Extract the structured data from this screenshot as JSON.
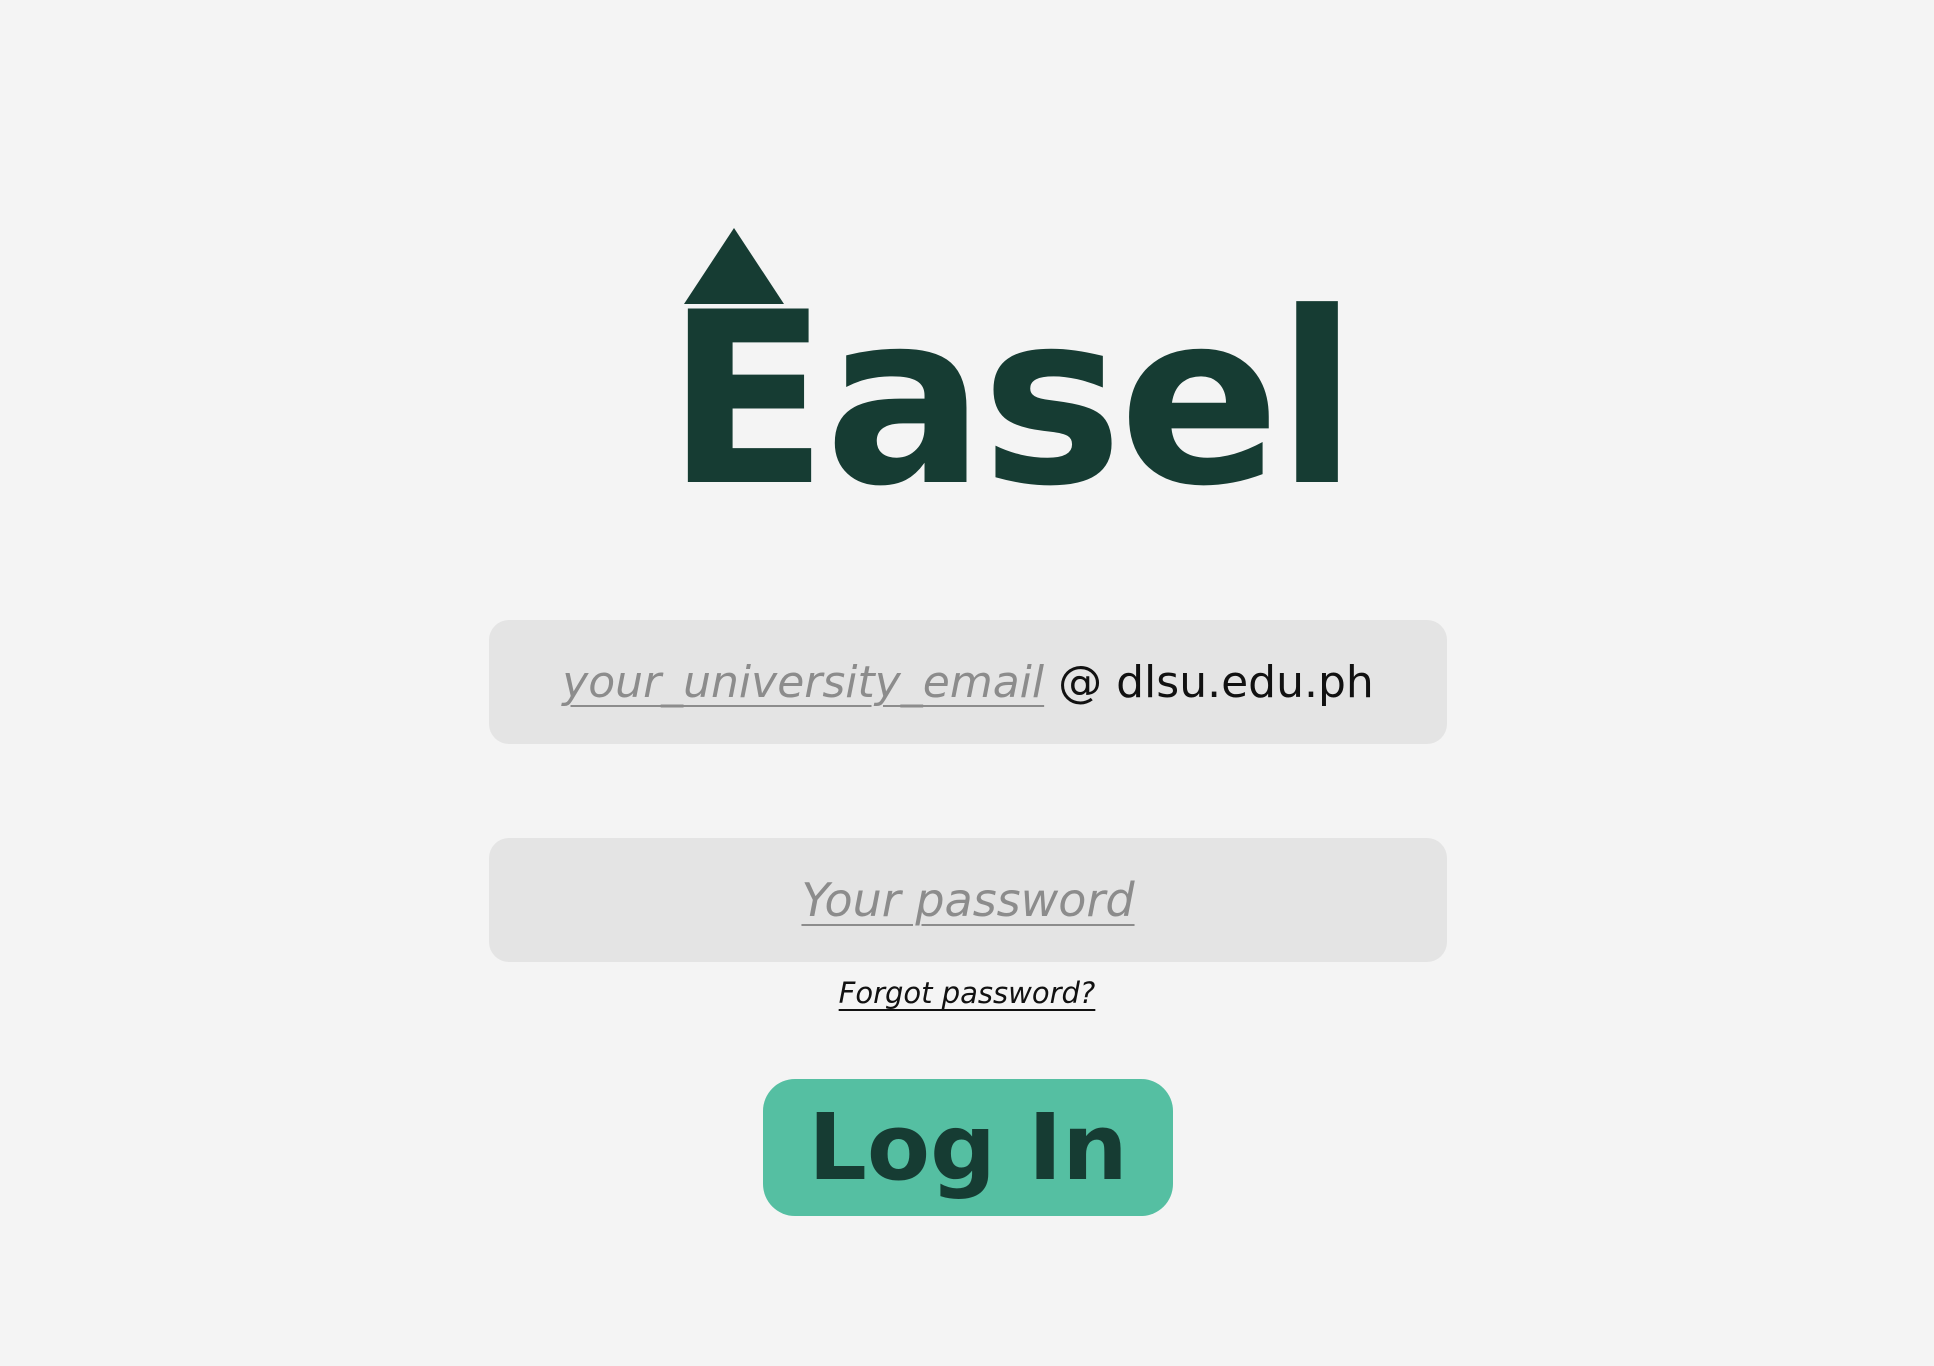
{
  "app": {
    "logo_text": "Easel"
  },
  "login_form": {
    "email_placeholder": "your_university_email",
    "email_domain": "@ dlsu.edu.ph",
    "password_placeholder": "Your password",
    "forgot_password_label": "Forgot password?",
    "login_button_label": "Log In"
  },
  "colors": {
    "background": "#f4f4f4",
    "brand_dark_green": "#163c33",
    "accent_green": "#55bfa2",
    "field_background": "#e4e4e4",
    "placeholder_gray": "#8c8c8c"
  }
}
